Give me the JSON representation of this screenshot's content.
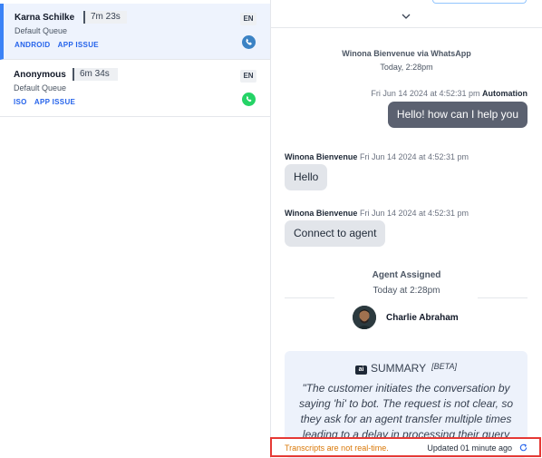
{
  "conversations": [
    {
      "name": "Karna Schilke",
      "timer": "7m 23s",
      "queue": "Default Queue",
      "tags": [
        "ANDROID",
        "APP ISSUE"
      ],
      "language": "EN",
      "channel_icon": "phone-icon"
    },
    {
      "name": "Anonymous",
      "timer": "6m 34s",
      "queue": "Default Queue",
      "tags": [
        "ISO",
        "APP ISSUE"
      ],
      "language": "EN",
      "channel_icon": "whatsapp-icon"
    }
  ],
  "transcript": {
    "system": {
      "title": "Winona Bienvenue via WhatsApp",
      "time": "Today, 2:28pm"
    },
    "messages": [
      {
        "meta_time": "Fri Jun 14 2024 at 4:52:31 pm",
        "meta_author": "Automation",
        "text": "Hello! how can I help you"
      },
      {
        "meta_author": "Winona Bienvenue",
        "meta_time": "Fri Jun 14 2024 at 4:52:31 pm",
        "text": "Hello"
      },
      {
        "meta_author": "Winona Bienvenue",
        "meta_time": "Fri Jun 14 2024 at 4:52:31 pm",
        "text": "Connect to agent"
      }
    ],
    "assignment": {
      "title": "Agent Assigned",
      "time": "Today at 2:28pm",
      "agent_name": "Charlie Abraham"
    },
    "summary": {
      "icon_text": "ai",
      "heading": "SUMMARY",
      "badge": "[BETA]",
      "text": "\"The customer initiates the conversation by saying 'hi' to bot. The request is not clear, so they ask for an agent transfer multiple times leading to a delay in processing their query"
    }
  },
  "status_bar": {
    "notice": "Transcripts are not real-time.",
    "updated": "Updated 01 minute ago"
  },
  "colors": {
    "accent": "#3b82f6",
    "notice": "#d97706",
    "highlight_border": "#e53935",
    "outgoing_bubble": "#5b6170"
  }
}
